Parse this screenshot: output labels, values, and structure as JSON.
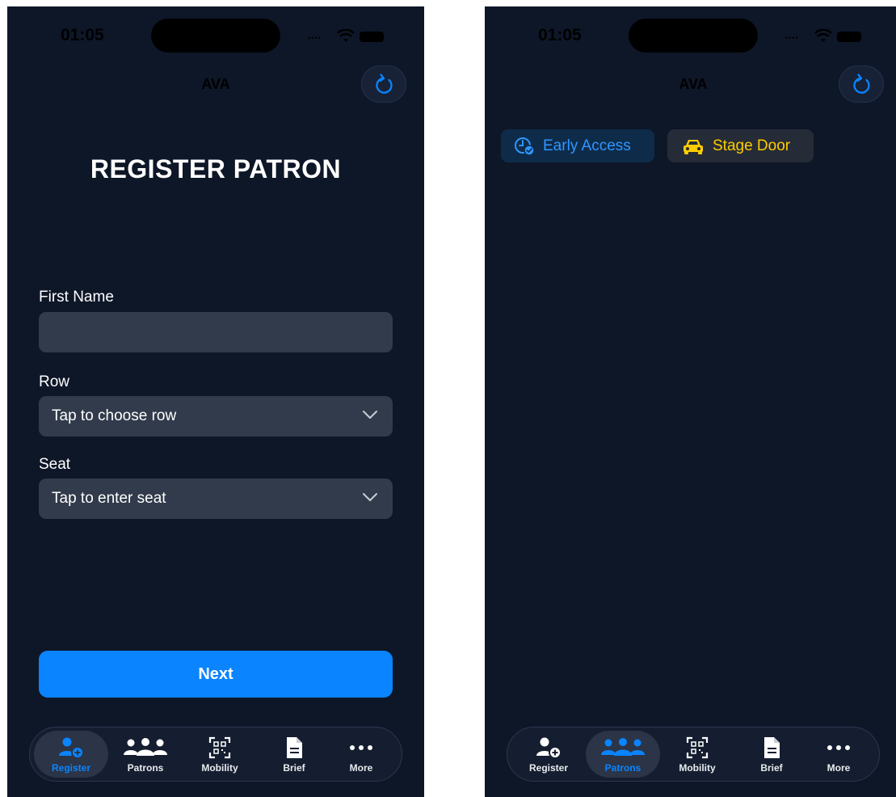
{
  "screens": [
    {
      "status_time": "01:05",
      "nav_title": "AVA",
      "page_title": "REGISTER PATRON",
      "form": {
        "first_name_label": "First Name",
        "first_name_value": "",
        "row_label": "Row",
        "row_value": "Tap to choose row",
        "seat_label": "Seat",
        "seat_value": "Tap to enter seat"
      },
      "next_label": "Next",
      "active_tab": "Register"
    },
    {
      "status_time": "01:05",
      "nav_title": "AVA",
      "chips": [
        {
          "label": "Early Access",
          "icon": "clock-check-icon",
          "color": "#2f96ff"
        },
        {
          "label": "Stage Door",
          "icon": "car-icon",
          "color": "#ffcc00"
        }
      ],
      "active_tab": "Patrons"
    }
  ],
  "tabs": [
    {
      "label": "Register",
      "icon": "person-add-icon"
    },
    {
      "label": "Patrons",
      "icon": "people-group-icon"
    },
    {
      "label": "Mobility",
      "icon": "qr-code-icon"
    },
    {
      "label": "Brief",
      "icon": "document-icon"
    },
    {
      "label": "More",
      "icon": "ellipsis-icon"
    }
  ],
  "colors": {
    "background": "#0e1728",
    "accent": "#0a84ff",
    "field": "#313b4b",
    "stage_door": "#ffcc00"
  }
}
